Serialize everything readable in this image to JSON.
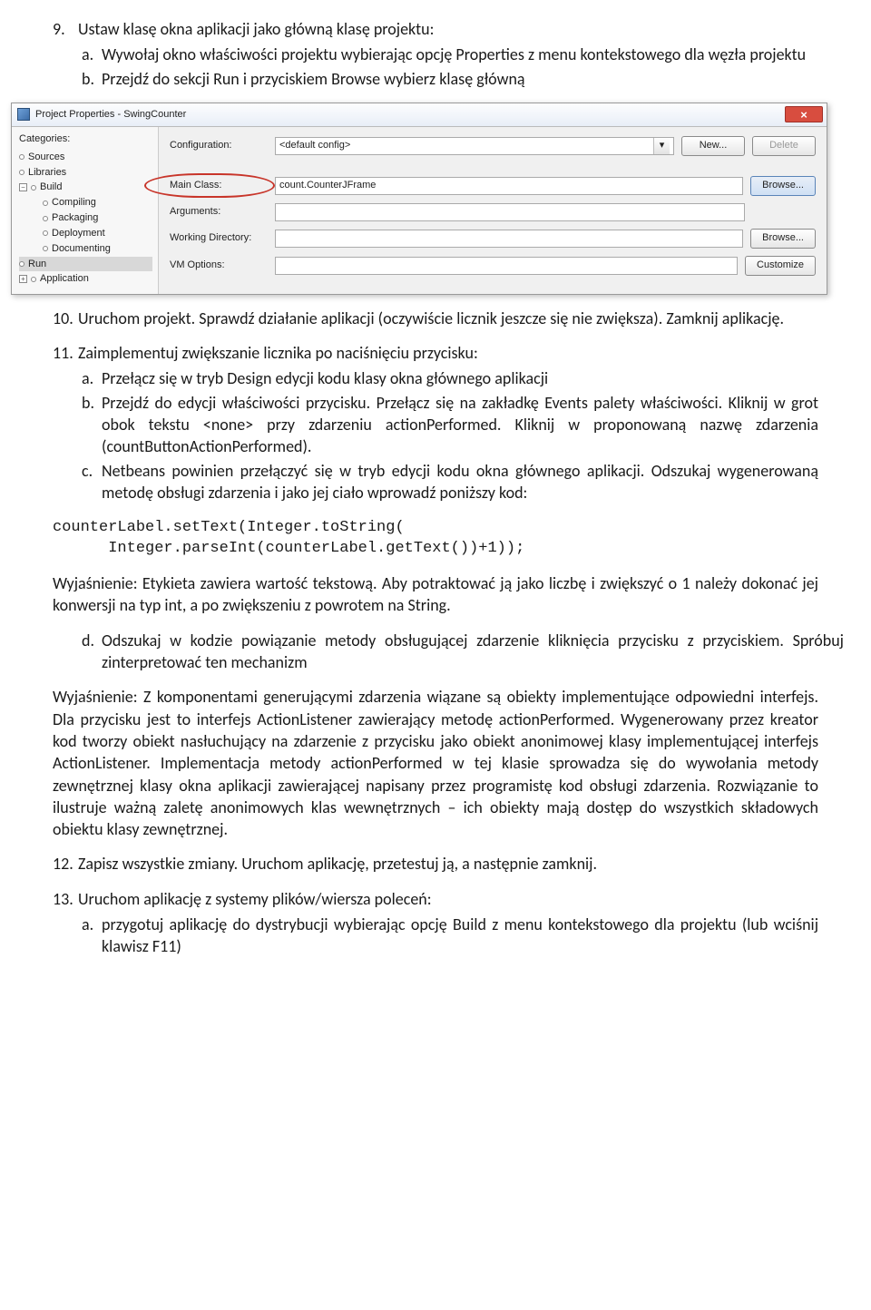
{
  "step9": {
    "num": "9.",
    "head": "Ustaw klasę okna aplikacji jako główną klasę projektu:",
    "a_letter": "a.",
    "a_text": "Wywołaj okno właściwości projektu wybierając opcję Properties z menu kontekstowego dla węzła projektu",
    "b_letter": "b.",
    "b_text": "Przejdź do sekcji Run i przyciskiem Browse wybierz klasę główną"
  },
  "dialog": {
    "title": "Project Properties - SwingCounter",
    "close": "×",
    "categories_label": "Categories:",
    "tree": {
      "sources": "Sources",
      "libraries": "Libraries",
      "build": "Build",
      "compiling": "Compiling",
      "packaging": "Packaging",
      "deployment": "Deployment",
      "documenting": "Documenting",
      "run": "Run",
      "application": "Application"
    },
    "form": {
      "config_label": "Configuration:",
      "config_value": "<default config>",
      "mainclass_label": "Main Class:",
      "mainclass_value": "count.CounterJFrame",
      "arguments_label": "Arguments:",
      "workdir_label": "Working Directory:",
      "vmoptions_label": "VM Options:"
    },
    "buttons": {
      "new": "New...",
      "delete": "Delete",
      "browse": "Browse...",
      "customize": "Customize"
    }
  },
  "step10": {
    "num": "10.",
    "text": "Uruchom projekt. Sprawdź działanie aplikacji (oczywiście licznik jeszcze się nie zwiększa). Zamknij aplikację."
  },
  "step11": {
    "num": "11.",
    "head": "Zaimplementuj zwiększanie licznika po naciśnięciu przycisku:",
    "a_letter": "a.",
    "a_text": "Przełącz się w tryb Design edycji kodu klasy okna głównego aplikacji",
    "b_letter": "b.",
    "b_text": "Przejdź do edycji właściwości przycisku. Przełącz się na zakładkę Events palety właściwości. Kliknij w grot obok tekstu <none> przy zdarzeniu actionPerformed. Kliknij w proponowaną nazwę zdarzenia (countButtonActionPerformed).",
    "c_letter": "c.",
    "c_text": "Netbeans powinien przełączyć się w tryb edycji kodu okna głównego aplikacji. Odszukaj wygenerowaną metodę obsługi zdarzenia i jako jej ciało wprowadź poniższy kod:"
  },
  "code": "counterLabel.setText(Integer.toString(\n      Integer.parseInt(counterLabel.getText())+1));",
  "explain1": "Wyjaśnienie: Etykieta zawiera wartość tekstową. Aby potraktować ją jako liczbę i zwiększyć o 1 należy dokonać jej konwersji na typ int, a po zwiększeniu z powrotem na String.",
  "d_letter": "d.",
  "d_text": "Odszukaj w kodzie powiązanie metody obsługującej zdarzenie kliknięcia przycisku z przyciskiem. Spróbuj zinterpretować ten mechanizm",
  "explain2": "Wyjaśnienie: Z komponentami generującymi zdarzenia wiązane są obiekty implementujące odpowiedni interfejs. Dla przycisku jest to interfejs ActionListener zawierający metodę actionPerformed. Wygenerowany przez kreator kod tworzy obiekt nasłuchujący na zdarzenie z przycisku jako obiekt anonimowej klasy implementującej interfejs ActionListener. Implementacja metody actionPerformed w tej klasie sprowadza się do wywołania metody zewnętrznej klasy okna aplikacji zawierającej napisany przez programistę kod obsługi zdarzenia. Rozwiązanie to ilustruje ważną zaletę anonimowych klas wewnętrznych – ich obiekty mają dostęp do wszystkich składowych obiektu klasy zewnętrznej.",
  "step12": {
    "num": "12.",
    "text": "Zapisz wszystkie zmiany. Uruchom aplikację, przetestuj ją, a następnie zamknij."
  },
  "step13": {
    "num": "13.",
    "head": "Uruchom aplikację z systemy plików/wiersza poleceń:",
    "a_letter": "a.",
    "a_text": "przygotuj aplikację do dystrybucji wybierając opcję Build z menu kontekstowego dla projektu (lub wciśnij klawisz F11)"
  }
}
